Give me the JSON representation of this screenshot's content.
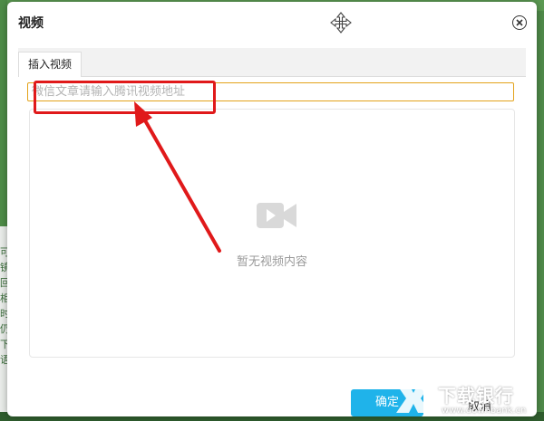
{
  "dialog": {
    "title": "视频",
    "tab": "插入视频",
    "url_placeholder": "微信文章请输入腾讯视频地址",
    "empty_text": "暂无视频内容",
    "confirm_label": "确定",
    "cancel_label": "取消"
  },
  "background": {
    "side_text": "可\n镜\n回\n相\n时\n仍\n下\n语"
  },
  "icons": {
    "move": "move-arrows-icon",
    "close": "close-circle-icon",
    "video": "video-camera-icon"
  },
  "annotations": {
    "highlight_color": "#e0191a"
  },
  "watermark": {
    "title": "下载银行",
    "url": "www.downbank.cn"
  },
  "colors": {
    "input_border": "#e3a21a",
    "confirm_button": "#1fb3ea"
  }
}
